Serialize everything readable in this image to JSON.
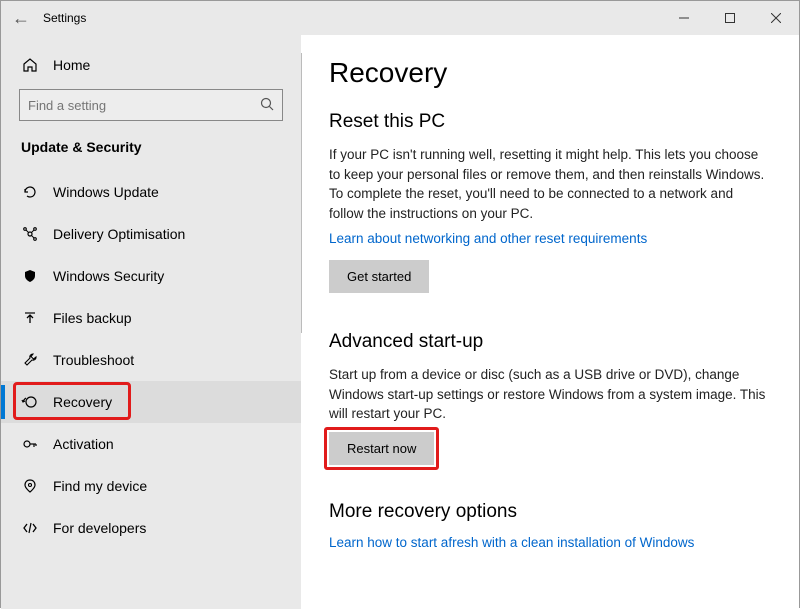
{
  "window": {
    "title": "Settings"
  },
  "sidebar": {
    "home": "Home",
    "searchPlaceholder": "Find a setting",
    "category": "Update & Security",
    "items": [
      {
        "label": "Windows Update"
      },
      {
        "label": "Delivery Optimisation"
      },
      {
        "label": "Windows Security"
      },
      {
        "label": "Files backup"
      },
      {
        "label": "Troubleshoot"
      },
      {
        "label": "Recovery"
      },
      {
        "label": "Activation"
      },
      {
        "label": "Find my device"
      },
      {
        "label": "For developers"
      }
    ]
  },
  "main": {
    "heading": "Recovery",
    "reset": {
      "title": "Reset this PC",
      "body": "If your PC isn't running well, resetting it might help. This lets you choose to keep your personal files or remove them, and then reinstalls Windows. To complete the reset, you'll need to be connected to a network and follow the instructions on your PC.",
      "link": "Learn about networking and other reset requirements",
      "button": "Get started"
    },
    "advanced": {
      "title": "Advanced start-up",
      "body": "Start up from a device or disc (such as a USB drive or DVD), change Windows start-up settings or restore Windows from a system image. This will restart your PC.",
      "button": "Restart now"
    },
    "more": {
      "title": "More recovery options",
      "link": "Learn how to start afresh with a clean installation of Windows"
    }
  }
}
